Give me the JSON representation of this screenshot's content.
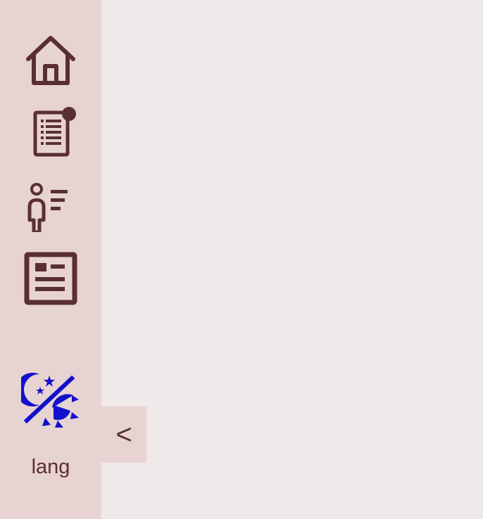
{
  "sidebar": {
    "items": [
      {
        "icon": "home-icon"
      },
      {
        "icon": "notes-icon",
        "has_notification": true
      },
      {
        "icon": "profile-list-icon"
      },
      {
        "icon": "newspaper-icon"
      }
    ],
    "theme_toggle_icon": "theme-toggle-icon",
    "lang_label": "lang",
    "collapse_label": "<"
  },
  "colors": {
    "sidebar_bg": "#e8d3d3",
    "main_bg": "#efe9e9",
    "icon": "#5a2f33",
    "theme_icon": "#1111cc"
  }
}
